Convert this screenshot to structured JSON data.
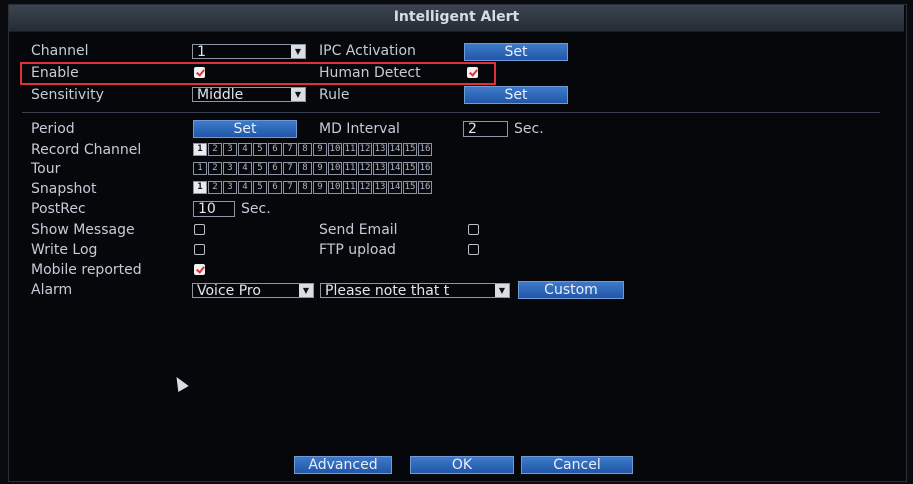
{
  "title": "Intelligent Alert",
  "labels": {
    "channel": "Channel",
    "enable": "Enable",
    "sensitivity": "Sensitivity",
    "period": "Period",
    "record_channel": "Record Channel",
    "tour": "Tour",
    "snapshot": "Snapshot",
    "postrec": "PostRec",
    "show_message": "Show Message",
    "write_log": "Write Log",
    "mobile_reported": "Mobile reported",
    "alarm": "Alarm",
    "ipc_activation": "IPC Activation",
    "human_detect": "Human Detect",
    "rule": "Rule",
    "md_interval": "MD Interval",
    "send_email": "Send Email",
    "ftp_upload": "FTP upload"
  },
  "values": {
    "channel": "1",
    "sensitivity": "Middle",
    "md_interval": "2",
    "md_interval_unit": "Sec.",
    "postrec": "10",
    "postrec_unit": "Sec.",
    "alarm_voice": "Voice Pro",
    "alarm_message": "Please note that t"
  },
  "checks": {
    "enable": true,
    "human_detect": true,
    "show_message": false,
    "write_log": false,
    "mobile_reported": true,
    "send_email": false,
    "ftp_upload": false
  },
  "buttons": {
    "ipc_set": "Set",
    "rule_set": "Set",
    "period_set": "Set",
    "custom": "Custom",
    "advanced": "Advanced",
    "ok": "OK",
    "cancel": "Cancel"
  },
  "channels": [
    "1",
    "2",
    "3",
    "4",
    "5",
    "6",
    "7",
    "8",
    "9",
    "10",
    "11",
    "12",
    "13",
    "14",
    "15",
    "16"
  ],
  "record_channel_selected": [
    1
  ],
  "tour_selected": [],
  "snapshot_selected": [
    1
  ],
  "colors": {
    "highlight": "#e0303a",
    "button": "#2f68ba",
    "check_mark": "#dd3333"
  }
}
